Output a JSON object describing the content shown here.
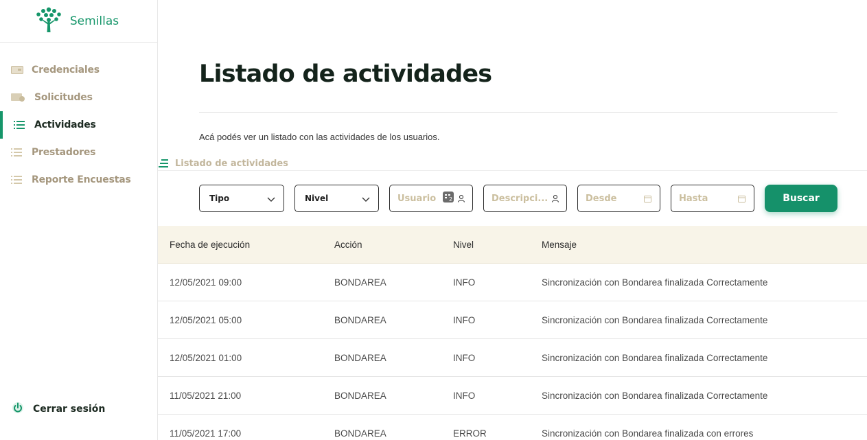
{
  "brand": {
    "name": "Semillas",
    "logo": "tree-logo",
    "color": "#16966a"
  },
  "sidebar": {
    "items": [
      {
        "label": "Credenciales",
        "icon": "credential-card-icon",
        "active": false
      },
      {
        "label": "Solicitudes",
        "icon": "requests-icon",
        "active": false
      },
      {
        "label": "Actividades",
        "icon": "list-icon",
        "active": true
      },
      {
        "label": "Prestadores",
        "icon": "list-icon",
        "active": false
      },
      {
        "label": "Reporte Encuestas",
        "icon": "list-icon",
        "active": false
      }
    ],
    "logout": {
      "label": "Cerrar sesión",
      "icon": "power-icon"
    }
  },
  "page": {
    "title": "Listado de actividades",
    "description": "Acá podés ver un listado con las actividades de los usuarios.",
    "section_label": "Listado de actividades"
  },
  "filters": {
    "tipo": {
      "value": "Tipo",
      "icon": "chevron-down-icon"
    },
    "nivel": {
      "value": "Nivel",
      "icon": "chevron-down-icon"
    },
    "usuario": {
      "placeholder": "Usuario",
      "icon": "user-icon"
    },
    "descripcion": {
      "placeholder": "Descripci...",
      "icon": "user-icon"
    },
    "desde": {
      "placeholder": "Desde",
      "icon": "calendar-icon"
    },
    "hasta": {
      "placeholder": "Hasta",
      "icon": "calendar-icon"
    },
    "search_button": "Buscar"
  },
  "table": {
    "headers": [
      "Fecha de ejecución",
      "Acción",
      "Nivel",
      "Mensaje"
    ],
    "rows": [
      {
        "fecha": "12/05/2021 09:00",
        "accion": "BONDAREA",
        "nivel": "INFO",
        "mensaje": "Sincronización con Bondarea finalizada Correctamente"
      },
      {
        "fecha": "12/05/2021 05:00",
        "accion": "BONDAREA",
        "nivel": "INFO",
        "mensaje": "Sincronización con Bondarea finalizada Correctamente"
      },
      {
        "fecha": "12/05/2021 01:00",
        "accion": "BONDAREA",
        "nivel": "INFO",
        "mensaje": "Sincronización con Bondarea finalizada Correctamente"
      },
      {
        "fecha": "11/05/2021 21:00",
        "accion": "BONDAREA",
        "nivel": "INFO",
        "mensaje": "Sincronización con Bondarea finalizada Correctamente"
      },
      {
        "fecha": "11/05/2021 17:00",
        "accion": "BONDAREA",
        "nivel": "ERROR",
        "mensaje": "Sincronización con Bondarea finalizada con errores"
      }
    ]
  },
  "colors": {
    "accent": "#16966a",
    "muted": "#a5977e",
    "header_bg": "#f8f4e8"
  }
}
